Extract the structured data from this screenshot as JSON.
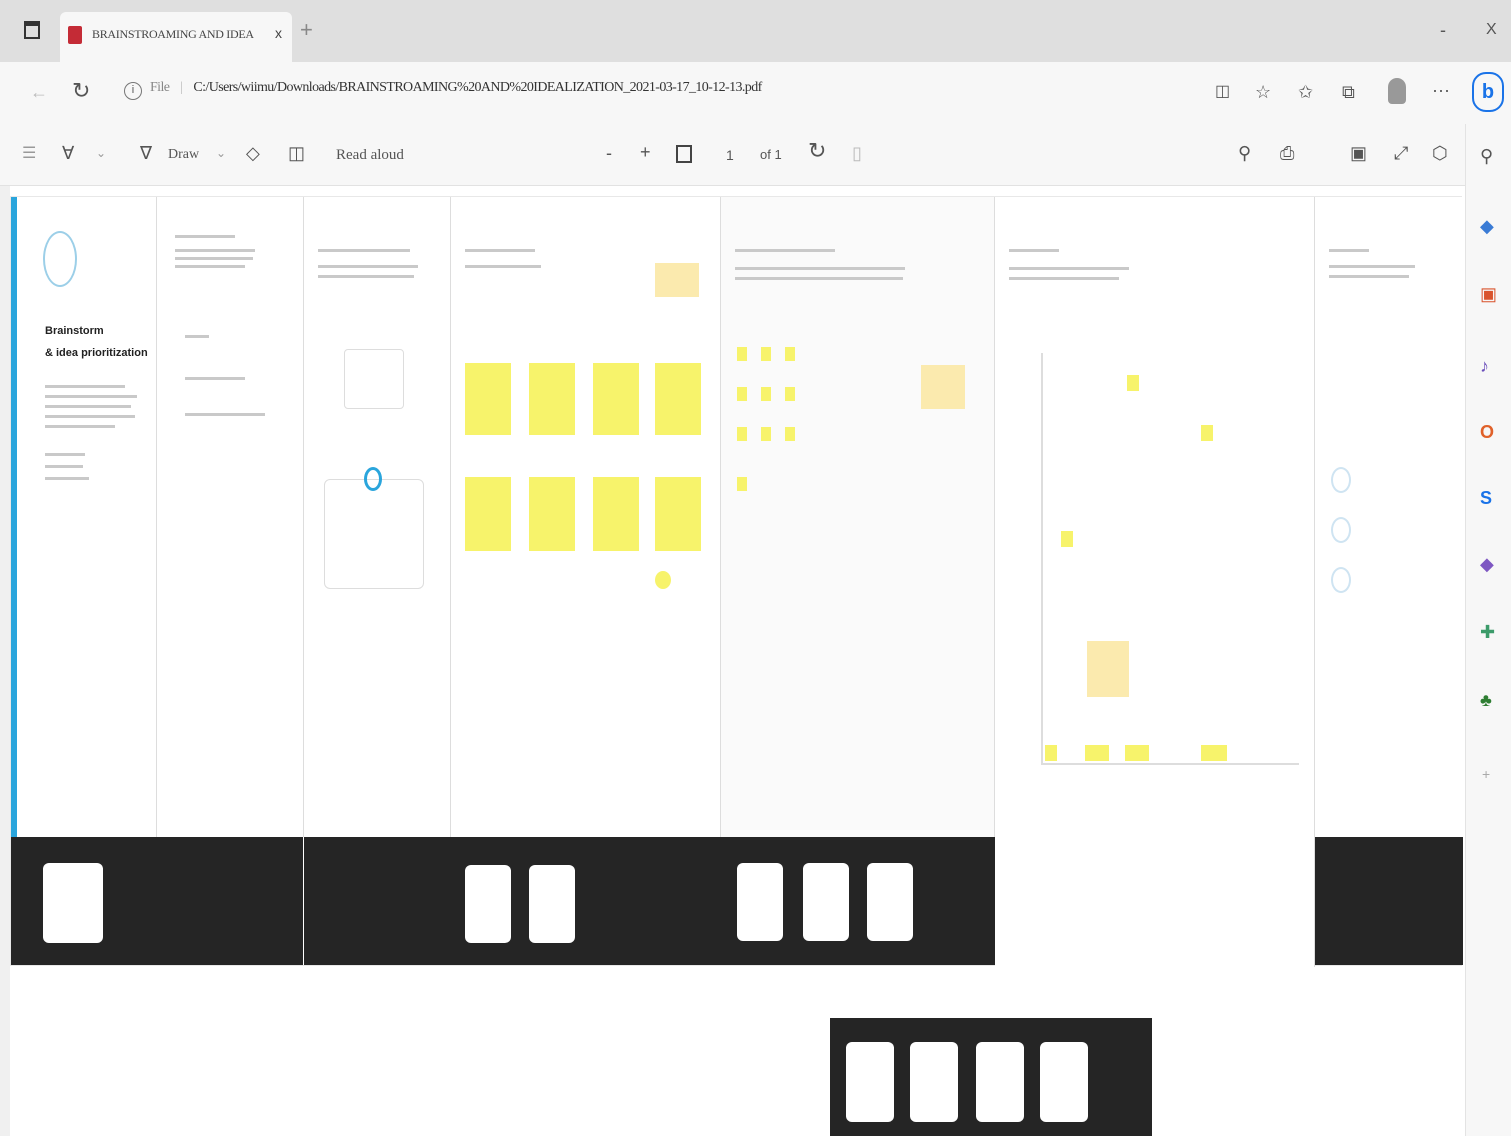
{
  "browser": {
    "tab_title": "BRAINSTROAMING AND IDEA",
    "tab_close": "x",
    "new_tab": "+",
    "minimize": "-",
    "close": "X",
    "url_prefix": "File",
    "url": "C:/Users/wiimu/Downloads/BRAINSTROAMING%20AND%20IDEALIZATION_2021-03-17_10-12-13.pdf"
  },
  "pdf_toolbar": {
    "draw_label": "Draw",
    "read_aloud": "Read aloud",
    "zoom_out": "-",
    "zoom_in": "+",
    "page_number": "1",
    "page_total": "of 1"
  },
  "board": {
    "intro_title_line1": "Brainstorm",
    "intro_title_line2": "& idea prioritization"
  },
  "colors": {
    "accent": "#0078d4",
    "sticky": "#f7f36b",
    "dark_band": "#252525",
    "stripe": "#2aa5dc"
  },
  "icons": [
    "tab-actions-icon",
    "pdf-file-icon",
    "refresh-icon",
    "info-icon",
    "read-mode-icon",
    "favorite-icon",
    "collections-icon",
    "profile-icon",
    "more-icon",
    "bing-icon",
    "contents-icon",
    "highlight-icon",
    "draw-icon",
    "eraser-icon",
    "page-view-icon",
    "fit-page-icon",
    "rotate-icon",
    "search-icon",
    "print-icon",
    "save-icon",
    "save-as-icon",
    "pin-icon",
    "sidebar-tag-icon",
    "shopping-icon",
    "office-icon",
    "outlook-icon",
    "skype-icon",
    "games-icon",
    "tools-icon",
    "tree-icon",
    "add-icon"
  ]
}
